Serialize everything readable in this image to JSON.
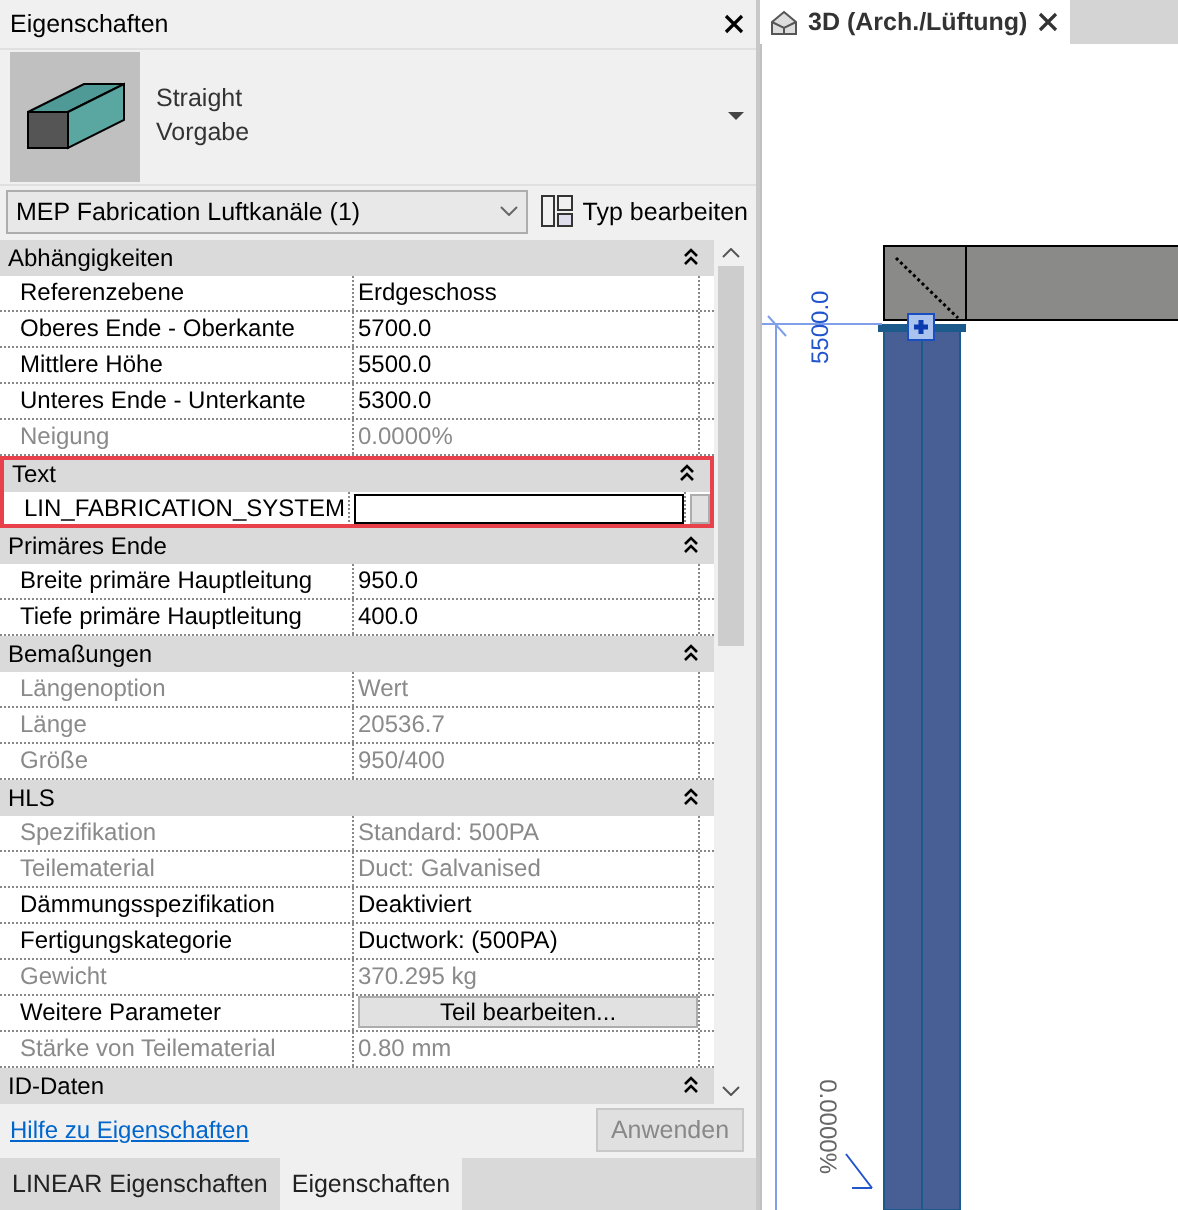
{
  "panel": {
    "title": "Eigenschaften"
  },
  "type_selector": {
    "name": "Straight",
    "subname": "Vorgabe"
  },
  "instance_filter": {
    "value": "MEP Fabrication Luftkanäle (1)"
  },
  "edit_type_button": {
    "label": "Typ bearbeiten"
  },
  "groups": [
    {
      "title": "Abhängigkeiten",
      "highlighted": false,
      "rows": [
        {
          "name": "Referenzebene",
          "value": "Erdgeschoss",
          "kind": "text",
          "disabled": false
        },
        {
          "name": "Oberes Ende - Oberkante",
          "value": "5700.0",
          "kind": "text",
          "disabled": false
        },
        {
          "name": "Mittlere Höhe",
          "value": "5500.0",
          "kind": "text",
          "disabled": false
        },
        {
          "name": "Unteres Ende - Unterkante",
          "value": "5300.0",
          "kind": "text",
          "disabled": false
        },
        {
          "name": "Neigung",
          "value": "0.0000%",
          "kind": "text",
          "disabled": true
        }
      ]
    },
    {
      "title": "Text",
      "highlighted": true,
      "rows": [
        {
          "name": "LIN_FABRICATION_SYSTEM",
          "kind": "field",
          "disabled": false
        }
      ]
    },
    {
      "title": "Primäres Ende",
      "highlighted": false,
      "rows": [
        {
          "name": "Breite primäre Hauptleitung",
          "value": "950.0",
          "kind": "text",
          "disabled": false
        },
        {
          "name": "Tiefe primäre Hauptleitung",
          "value": "400.0",
          "kind": "text",
          "disabled": false
        }
      ]
    },
    {
      "title": "Bemaßungen",
      "highlighted": false,
      "rows": [
        {
          "name": "Längenoption",
          "value": "Wert",
          "kind": "text",
          "disabled": true
        },
        {
          "name": "Länge",
          "value": "20536.7",
          "kind": "text",
          "disabled": true
        },
        {
          "name": "Größe",
          "value": "950/400",
          "kind": "text",
          "disabled": true
        }
      ]
    },
    {
      "title": "HLS",
      "highlighted": false,
      "rows": [
        {
          "name": "Spezifikation",
          "value": "Standard: 500PA",
          "kind": "text",
          "disabled": true
        },
        {
          "name": "Teilematerial",
          "value": "Duct: Galvanised",
          "kind": "text",
          "disabled": true
        },
        {
          "name": "Dämmungsspezifikation",
          "value": "Deaktiviert",
          "kind": "text",
          "disabled": false
        },
        {
          "name": "Fertigungskategorie",
          "value": "Ductwork: (500PA)",
          "kind": "text",
          "disabled": false
        },
        {
          "name": "Gewicht",
          "value": "370.295 kg",
          "kind": "text",
          "disabled": true
        },
        {
          "name": "Weitere Parameter",
          "value": "Teil bearbeiten...",
          "kind": "button",
          "disabled": false
        },
        {
          "name": "Stärke von Teilematerial",
          "value": "0.80 mm",
          "kind": "text",
          "disabled": true
        }
      ]
    },
    {
      "title": "ID-Daten",
      "highlighted": false
    }
  ],
  "help_link": "Hilfe zu Eigenschaften",
  "apply_button": {
    "label": "Anwenden",
    "disabled": true
  },
  "bottom_tabs": [
    {
      "label": "LINEAR Eigenschaften",
      "selected": false
    },
    {
      "label": "Eigenschaften",
      "selected": true
    }
  ],
  "view_tab": {
    "title": "3D (Arch./Lüftung)"
  },
  "view": {
    "dimension": "5500.0",
    "slope": "0.0000%"
  }
}
